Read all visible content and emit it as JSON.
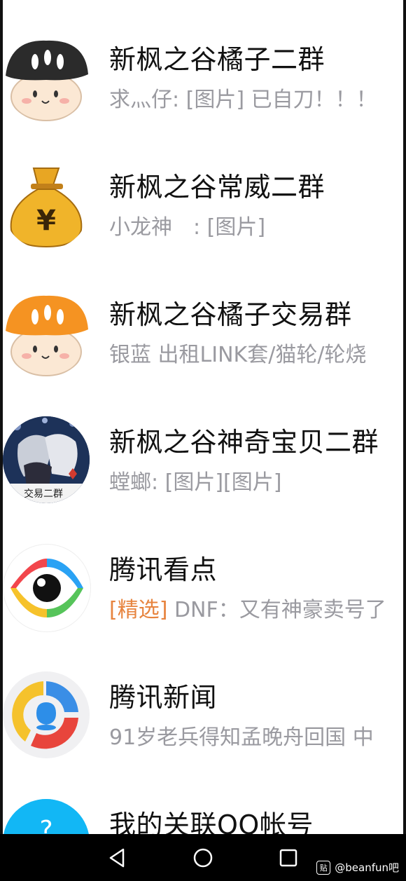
{
  "conversations": [
    {
      "title": "新枫之谷橘子二群",
      "preview": "求灬仔: [图片] 已自刀！！！",
      "avatar": "black-mushroom-icon"
    },
    {
      "title": "新枫之谷常威二群",
      "preview": "小龙神　: [图片]",
      "avatar": "money-bag-icon"
    },
    {
      "title": "新枫之谷橘子交易群",
      "preview": "银蓝 出租LINK套/猫轮/轮烧",
      "avatar": "orange-mushroom-icon"
    },
    {
      "title": "新枫之谷神奇宝贝二群",
      "preview": "螳螂: [图片][图片]",
      "avatar": "anime-group-avatar",
      "avatar_text": "交易二群"
    },
    {
      "title": "腾讯看点",
      "tag": "[精选]",
      "preview": " DNF：又有神豪卖号了",
      "avatar": "eye-logo-icon"
    },
    {
      "title": "腾讯新闻",
      "preview": "91岁老兵得知孟晚舟回国 中",
      "avatar": "qq-news-logo-icon"
    },
    {
      "title": "我的关联QQ帐号",
      "preview": "",
      "avatar": "qq-link-icon"
    }
  ],
  "navbar": {
    "back": "back-icon",
    "home": "home-icon",
    "recent": "recent-apps-icon"
  },
  "watermark": {
    "logo": "贴",
    "text": "@beanfun吧"
  },
  "colors": {
    "tag": "#e7843f",
    "preview": "#9a9aa0",
    "title": "#111111"
  }
}
